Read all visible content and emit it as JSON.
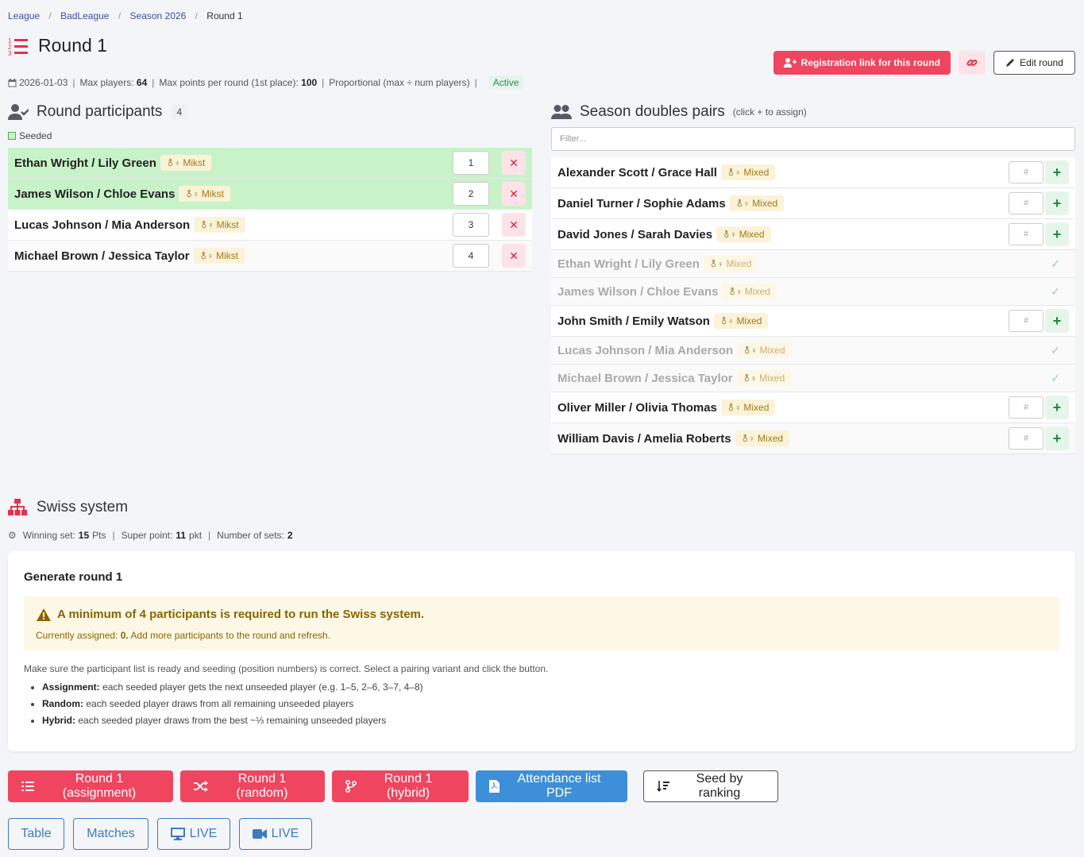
{
  "breadcrumb": {
    "items": [
      "League",
      "BadLeague",
      "Season 2026"
    ],
    "current": "Round 1"
  },
  "page": {
    "title": "Round 1"
  },
  "top_buttons": {
    "registration": "Registration link for this round",
    "edit": "Edit round"
  },
  "meta": {
    "date": "2026-01-03",
    "max_players_label": "Max players:",
    "max_players": "64",
    "max_points_label": "Max points per round (1st place):",
    "max_points": "100",
    "proportional": "Proportional (max ÷ num players)",
    "status": "Active"
  },
  "participants": {
    "title": "Round participants",
    "count": "4",
    "seeded_label": "Seeded",
    "rows": [
      {
        "name": "Ethan Wright / Lily Green",
        "tag": "Mikst",
        "seed": "1",
        "seeded": true
      },
      {
        "name": "James Wilson / Chloe Evans",
        "tag": "Mikst",
        "seed": "2",
        "seeded": true
      },
      {
        "name": "Lucas Johnson / Mia Anderson",
        "tag": "Mikst",
        "seed": "3",
        "seeded": false
      },
      {
        "name": "Michael Brown / Jessica Taylor",
        "tag": "Mikst",
        "seed": "4",
        "seeded": false
      }
    ]
  },
  "pairs": {
    "title": "Season doubles pairs",
    "hint": "(click + to assign)",
    "filter_placeholder": "Filter...",
    "input_placeholder": "#",
    "rows": [
      {
        "name": "Alexander Scott / Grace Hall",
        "tag": "Mixed",
        "assigned": false
      },
      {
        "name": "Daniel Turner / Sophie Adams",
        "tag": "Mixed",
        "assigned": false
      },
      {
        "name": "David Jones / Sarah Davies",
        "tag": "Mixed",
        "assigned": false
      },
      {
        "name": "Ethan Wright / Lily Green",
        "tag": "Mixed",
        "assigned": true
      },
      {
        "name": "James Wilson / Chloe Evans",
        "tag": "Mixed",
        "assigned": true
      },
      {
        "name": "John Smith / Emily Watson",
        "tag": "Mixed",
        "assigned": false
      },
      {
        "name": "Lucas Johnson / Mia Anderson",
        "tag": "Mixed",
        "assigned": true
      },
      {
        "name": "Michael Brown / Jessica Taylor",
        "tag": "Mixed",
        "assigned": true
      },
      {
        "name": "Oliver Miller / Olivia Thomas",
        "tag": "Mixed",
        "assigned": false
      },
      {
        "name": "William Davis / Amelia Roberts",
        "tag": "Mixed",
        "assigned": false
      }
    ]
  },
  "swiss": {
    "title": "Swiss system",
    "winning_set_label": "Winning set:",
    "winning_set": "15",
    "winning_set_unit": "Pts",
    "super_point_label": "Super point:",
    "super_point": "11",
    "super_point_unit": "pkt",
    "num_sets_label": "Number of sets:",
    "num_sets": "2"
  },
  "generate": {
    "title": "Generate round 1",
    "alert_title": "A minimum of 4 participants is required to run the Swiss system.",
    "alert_sub_prefix": "Currently assigned:",
    "alert_sub_count": "0.",
    "alert_sub_suffix": "Add more participants to the round and refresh.",
    "desc": "Make sure the participant list is ready and seeding (position numbers) is correct. Select a pairing variant and click the button.",
    "items": [
      {
        "label": "Assignment:",
        "text": "each seeded player gets the next unseeded player (e.g. 1–5, 2–6, 3–7, 4–8)"
      },
      {
        "label": "Random:",
        "text": "each seeded player draws from all remaining unseeded players"
      },
      {
        "label": "Hybrid:",
        "text": "each seeded player draws from the best ~⅓ remaining unseeded players"
      }
    ]
  },
  "actions": {
    "assignment": "Round 1 (assignment)",
    "random": "Round 1 (random)",
    "hybrid": "Round 1 (hybrid)",
    "pdf": "Attendance list PDF",
    "seed": "Seed by ranking"
  },
  "views": {
    "table": "Table",
    "matches": "Matches",
    "live1": "LIVE",
    "live2": "LIVE"
  },
  "colors": {
    "accent_red": "#f0455f",
    "seeded_green": "#c8f3c8",
    "blue": "#3d8fd9",
    "active_green": "#2a8a52"
  }
}
